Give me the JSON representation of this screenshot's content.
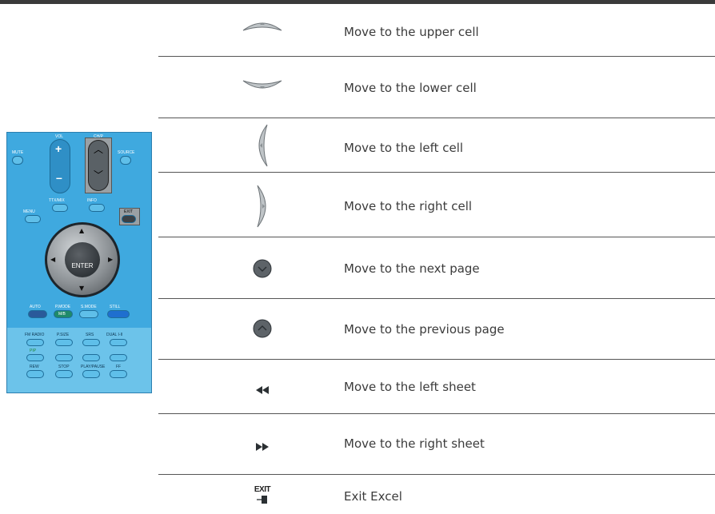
{
  "rows": [
    {
      "icon": "up-arrow-key-icon",
      "label": "Move to the upper cell"
    },
    {
      "icon": "down-arrow-key-icon",
      "label": "Move to the lower cell"
    },
    {
      "icon": "left-arrow-key-icon",
      "label": "Move to the left cell"
    },
    {
      "icon": "right-arrow-key-icon",
      "label": "Move to the right cell"
    },
    {
      "icon": "channel-down-button-icon",
      "label": "Move to the next page"
    },
    {
      "icon": "channel-up-button-icon",
      "label": "Move to the previous page"
    },
    {
      "icon": "rewind-icon",
      "label": "Move to the left sheet"
    },
    {
      "icon": "fast-forward-icon",
      "label": "Move to the right sheet"
    },
    {
      "icon": "exit-icon",
      "label": "Exit Excel",
      "icon_text": "EXIT"
    }
  ],
  "remote": {
    "labels": {
      "vol": "VOL",
      "chp": "CH/P",
      "mute": "MUTE",
      "source": "SOURCE",
      "ttx": "TTX/MIX",
      "info": "INFO",
      "menu": "MENU",
      "exit": "EXIT",
      "enter": "ENTER",
      "auto": "AUTO",
      "pmode": "P.MODE",
      "smode": "S.MODE",
      "still": "STILL",
      "mb": "M/B",
      "fm_radio": "FM RADIO",
      "psize": "P.SIZE",
      "srs": "SRS",
      "dual": "DUAL I-II",
      "pip": "PIP",
      "rew": "REW",
      "stop": "STOP",
      "play_pause": "PLAY/PAUSE",
      "ff": "FF"
    }
  }
}
